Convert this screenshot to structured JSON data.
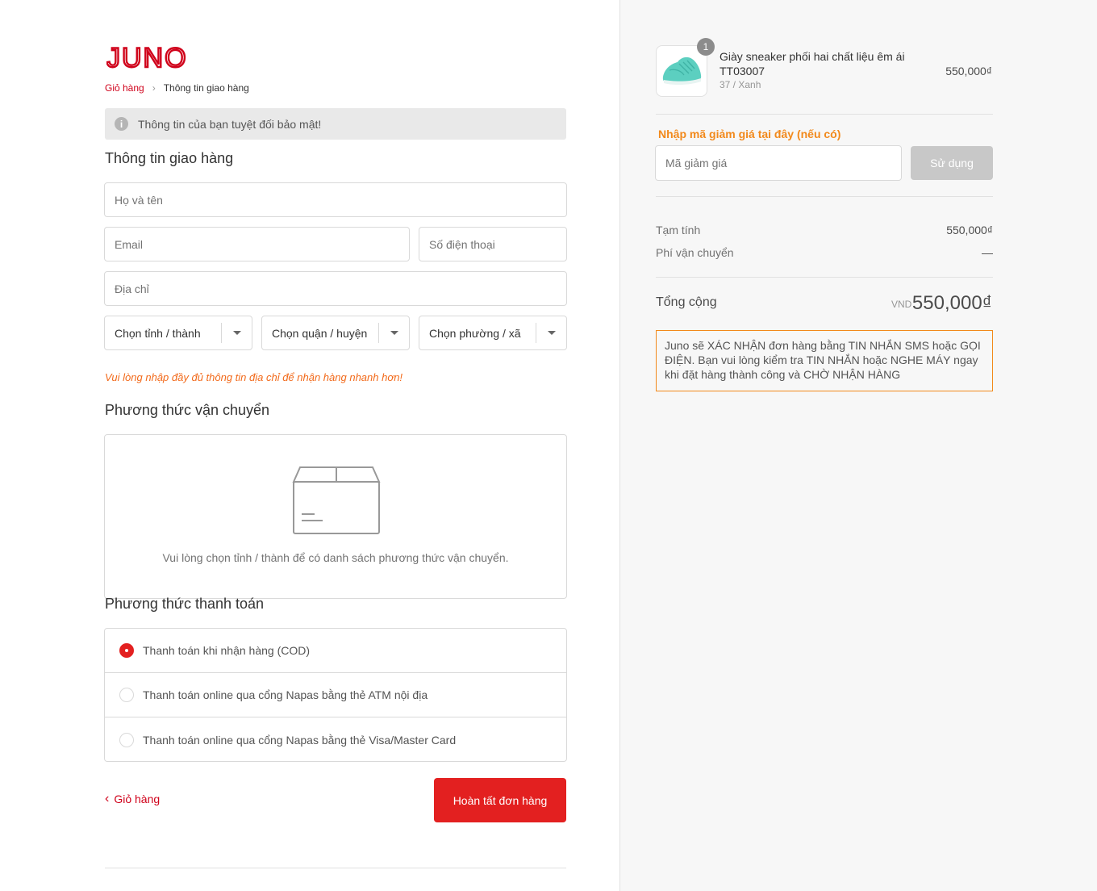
{
  "brand": {
    "logo_text": "JUNO",
    "color": "#d0021b"
  },
  "breadcrumb": {
    "cart": "Giỏ hàng",
    "separator": "›",
    "current": "Thông tin giao hàng"
  },
  "notice": {
    "icon": "info-icon",
    "text": "Thông tin của bạn tuyệt đối bảo mật!"
  },
  "shipping_info": {
    "title": "Thông tin giao hàng",
    "fullname_placeholder": "Họ và tên",
    "email_placeholder": "Email",
    "phone_placeholder": "Số điện thoại",
    "address_placeholder": "Địa chỉ",
    "province": "Chọn tỉnh / thành",
    "district": "Chọn quận / huyện",
    "ward": "Chọn phường / xã",
    "hint": "Vui lòng nhập đầy đủ thông tin địa chỉ để nhận hàng nhanh hơn!"
  },
  "shipping_method": {
    "title": "Phương thức vận chuyển",
    "empty_message": "Vui lòng chọn tỉnh / thành để có danh sách phương thức vận chuyển."
  },
  "payment_method": {
    "title": "Phương thức thanh toán",
    "options": [
      {
        "label": "Thanh toán khi nhận hàng (COD)",
        "selected": true
      },
      {
        "label": "Thanh toán online qua cổng Napas bằng thẻ ATM nội địa",
        "selected": false
      },
      {
        "label": "Thanh toán online qua cổng Napas bằng thẻ Visa/Master Card",
        "selected": false
      }
    ]
  },
  "actions": {
    "back_label": "Giỏ hàng",
    "complete_label": "Hoàn tất đơn hàng"
  },
  "order": {
    "product": {
      "quantity": "1",
      "name": "Giày sneaker phối hai chất liệu êm ái TT03007",
      "variant": "37 / Xanh",
      "price": "550,000₫"
    },
    "discount": {
      "label": "Nhập mã giảm giá tại đây (nếu có)",
      "placeholder": "Mã giảm giá",
      "button": "Sử dụng"
    },
    "subtotal_label": "Tạm tính",
    "subtotal_value": "550,000₫",
    "shipping_fee_label": "Phí vận chuyển",
    "shipping_fee_value": "—",
    "total_label": "Tổng cộng",
    "currency": "VND",
    "total_value": "550,000₫",
    "confirm_note": "Juno sẽ XÁC NHẬN đơn hàng bằng TIN NHẮN SMS hoặc GỌI ĐIỆN. Bạn vui lòng kiểm tra TIN NHẮN hoặc NGHE MÁY ngay khi đặt hàng thành công và CHỜ NHẬN HÀNG"
  },
  "colors": {
    "accent": "#e32020",
    "orange": "#f2891b",
    "hint": "#f26a1b"
  }
}
